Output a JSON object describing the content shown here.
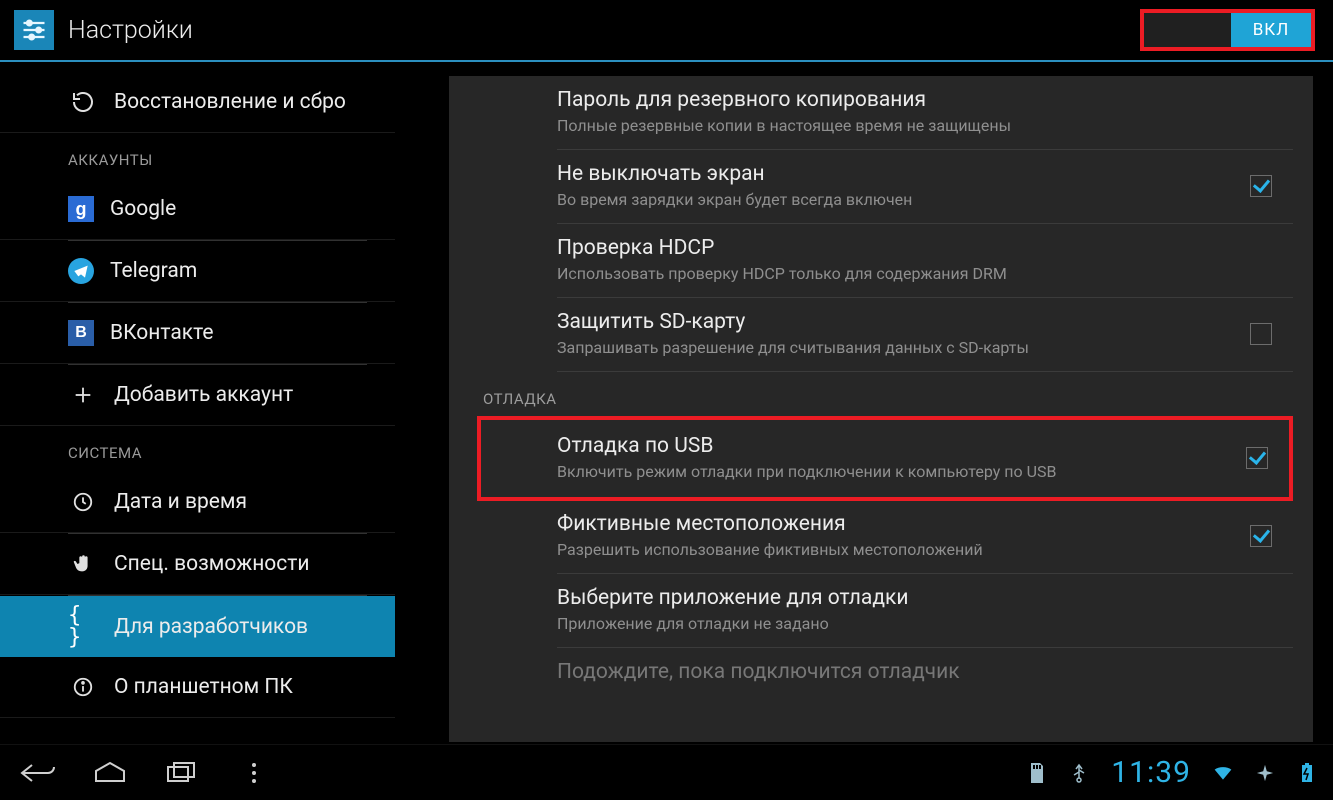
{
  "header": {
    "title": "Настройки",
    "switch_on_label": "ВКЛ"
  },
  "sidebar": {
    "items": [
      {
        "label": "Восстановление и сбро"
      }
    ],
    "accounts_header": "АККАУНТЫ",
    "accounts": [
      {
        "label": "Google"
      },
      {
        "label": "Telegram"
      },
      {
        "label": "ВКонтакте"
      },
      {
        "label": "Добавить аккаунт"
      }
    ],
    "system_header": "СИСТЕМА",
    "system": [
      {
        "label": "Дата и время"
      },
      {
        "label": "Спец. возможности"
      },
      {
        "label": "Для разработчиков",
        "selected": true
      },
      {
        "label": "О планшетном ПК"
      }
    ]
  },
  "content": {
    "rows": [
      {
        "title": "Пароль для резервного копирования",
        "subtitle": "Полные резервные копии в настоящее время не защищены",
        "control": "none"
      },
      {
        "title": "Не выключать экран",
        "subtitle": "Во время зарядки экран будет всегда включен",
        "control": "checked"
      },
      {
        "title": "Проверка HDCP",
        "subtitle": "Использовать проверку HDCP только для содержания DRM",
        "control": "none"
      },
      {
        "title": "Защитить SD-карту",
        "subtitle": "Запрашивать разрешение для считывания данных с SD-карты",
        "control": "unchecked"
      }
    ],
    "debug_header": "ОТЛАДКА",
    "debug_rows": [
      {
        "title": "Отладка по USB",
        "subtitle": "Включить режим отладки при подключении к компьютеру по USB",
        "control": "checked",
        "highlight": true
      },
      {
        "title": "Фиктивные местоположения",
        "subtitle": "Разрешить использование фиктивных местоположений",
        "control": "checked"
      },
      {
        "title": "Выберите приложение для отладки",
        "subtitle": "Приложение для отладки не задано",
        "control": "none"
      },
      {
        "title_faded": "Подождите, пока подключится отладчик"
      }
    ]
  },
  "status": {
    "time": "11:39"
  }
}
